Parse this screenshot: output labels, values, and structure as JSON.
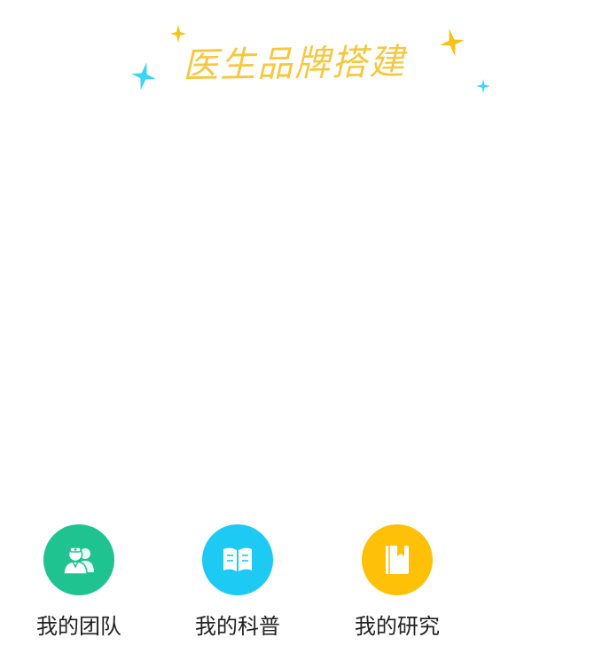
{
  "header": {
    "title": "医生品牌搭建"
  },
  "menu": {
    "items": [
      {
        "label": "我的团队",
        "icon": "team-icon",
        "color": "#1fc38f"
      },
      {
        "label": "我的科普",
        "icon": "book-open-icon",
        "color": "#1ccaf4"
      },
      {
        "label": "我的研究",
        "icon": "notebook-icon",
        "color": "#ffc107"
      }
    ]
  },
  "colors": {
    "title": "#f5c842",
    "sparkle_yellow": "#f5c21b",
    "sparkle_cyan": "#39d5f4"
  }
}
